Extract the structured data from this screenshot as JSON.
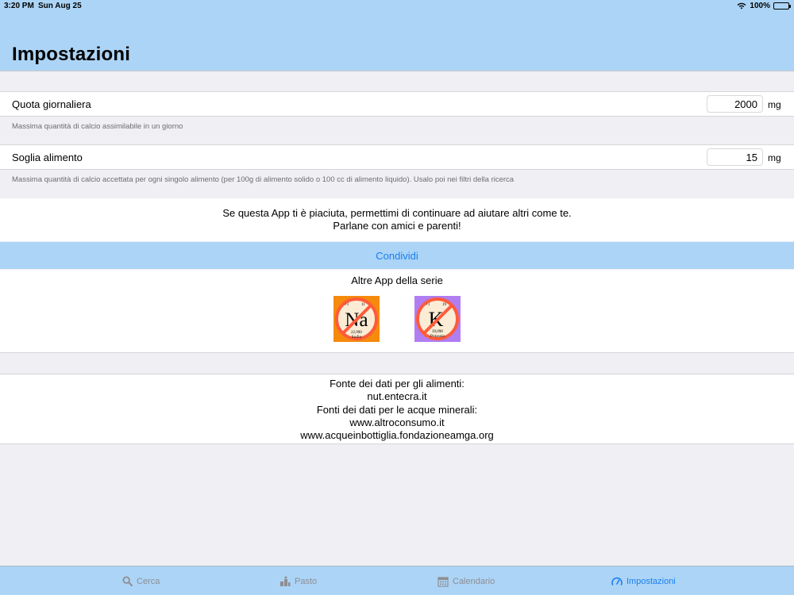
{
  "status_bar": {
    "time": "3:20 PM",
    "date": "Sun Aug 25",
    "battery": "100%",
    "icons": [
      "wifi-icon",
      "battery-icon"
    ]
  },
  "header": {
    "title": "Impostazioni"
  },
  "settings": [
    {
      "label": "Quota giornaliera",
      "value": "2000",
      "unit": "mg",
      "description": "Massima quantità di calcio assimilabile in un giorno"
    },
    {
      "label": "Soglia alimento",
      "value": "15",
      "unit": "mg",
      "description": "Massima quantità di calcio accettata per ogni singolo alimento (per 100g di alimento solido o 100 cc di alimento liquido). Usalo poi nei filtri della ricerca"
    }
  ],
  "promo": {
    "line1": "Se questa App ti è piaciuta, permettimi di continuare ad aiutare altri come te.",
    "line2": "Parlane con amici e parenti!",
    "share_label": "Condividi"
  },
  "other_apps": {
    "title": "Altre App della serie",
    "apps": [
      {
        "symbol": "Na",
        "name": "Sodio",
        "number_left": "+1",
        "number_right": "11",
        "mass": "22,990",
        "color": "#f58a0c"
      },
      {
        "symbol": "K",
        "name": "Potassio",
        "number_left": "+1",
        "number_right": "19",
        "mass": "39,098",
        "color": "#b07ef0"
      }
    ]
  },
  "sources": {
    "lines": [
      "Fonte dei dati per gli alimenti:",
      "nut.entecra.it",
      "Fonti dei dati per le acque minerali:",
      "www.altroconsumo.it",
      "www.acqueinbottiglia.fondazioneamga.org"
    ]
  },
  "tabbar": {
    "tabs": [
      {
        "label": "Cerca",
        "icon": "search-icon",
        "active": false
      },
      {
        "label": "Pasto",
        "icon": "meal-icon",
        "active": false
      },
      {
        "label": "Calendario",
        "icon": "calendar-icon",
        "active": false
      },
      {
        "label": "Impostazioni",
        "icon": "gauge-icon",
        "active": true
      }
    ],
    "active_color": "#1a7ff2",
    "inactive_color": "#8e8e93"
  }
}
